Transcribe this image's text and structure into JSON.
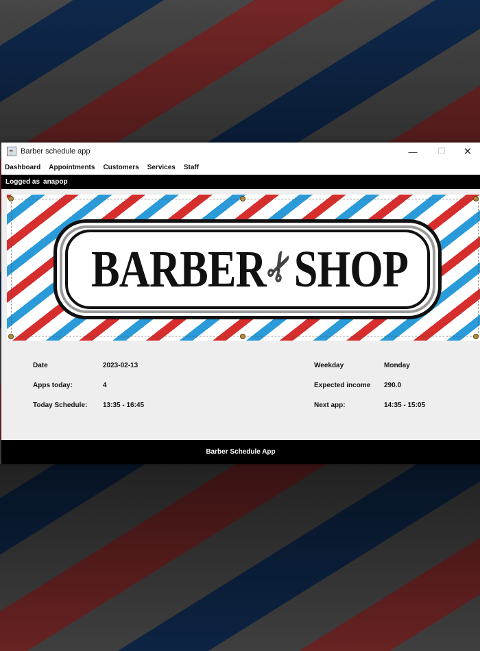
{
  "window": {
    "title": "Barber schedule app",
    "controls": {
      "minimize": "—",
      "maximize": "☐",
      "close": "✕"
    }
  },
  "menu": [
    "Dashboard",
    "Appointments",
    "Customers",
    "Services",
    "Staff"
  ],
  "session": {
    "label": "Logged as",
    "username": "anapop"
  },
  "banner": {
    "word_left": "BARBER",
    "word_right": "SHOP",
    "icon": "scissors-icon"
  },
  "stats": {
    "date": {
      "label": "Date",
      "value": "2023-02-13"
    },
    "apps_today": {
      "label": "Apps today:",
      "value": "4"
    },
    "today_schedule": {
      "label": "Today Schedule:",
      "value": "13:35 - 16:45"
    },
    "weekday": {
      "label": "Weekday",
      "value": "Monday"
    },
    "expected_income": {
      "label": "Expected income",
      "value": "290.0"
    },
    "next_app": {
      "label": "Next app:",
      "value": "14:35 - 15:05"
    }
  },
  "footer": {
    "text": "Barber Schedule App"
  },
  "colors": {
    "pole_red": "#d62d2d",
    "pole_blue": "#2a9ad8",
    "bar_black": "#000000",
    "panel": "#eeeeee"
  }
}
